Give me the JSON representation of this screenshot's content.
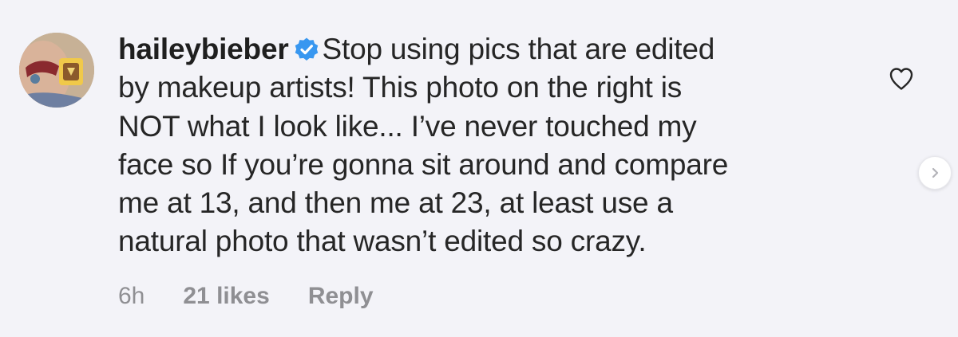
{
  "comment": {
    "username": "haileybieber",
    "verified": true,
    "text_lines": [
      "Stop using pics that are edited",
      "by makeup artists! This photo on the right is",
      "NOT what I look like... I’ve never touched my",
      "face so If you’re gonna sit around and compare",
      "me at 13, and then me at 23, at least use a",
      "natural photo that wasn’t edited so crazy."
    ],
    "time": "6h",
    "likes": "21 likes",
    "reply_label": "Reply"
  },
  "icons": {
    "avatar": "profile-photo",
    "verified": "verified-badge-icon",
    "like": "heart-outline-icon",
    "next": "chevron-right-icon"
  },
  "colors": {
    "background": "#f3f3f8",
    "text": "#262626",
    "meta_text": "#8f8f93",
    "verified_blue": "#3897f0"
  }
}
